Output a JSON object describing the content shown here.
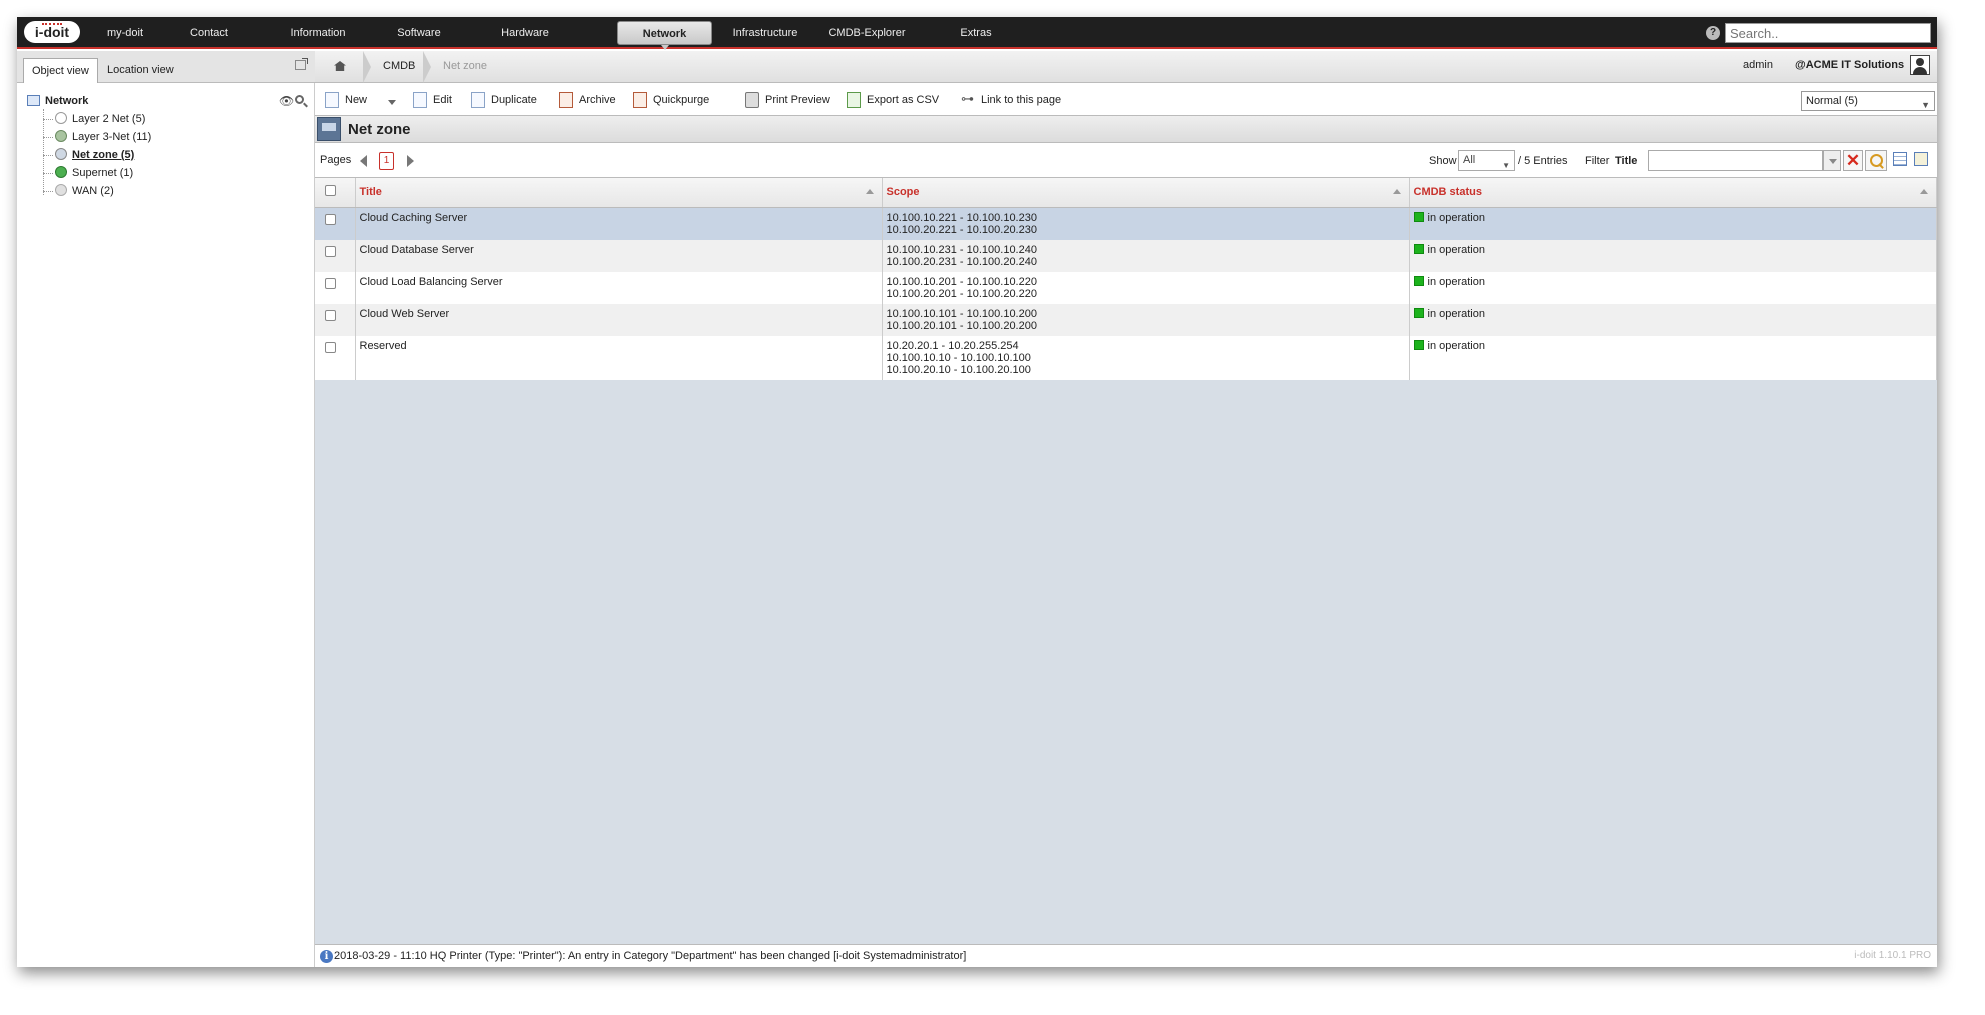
{
  "app": {
    "logo_text": "i-doit"
  },
  "topnav": {
    "items": [
      "my-doit",
      "Contact",
      "Information",
      "Software",
      "Hardware",
      "Network",
      "Infrastructure",
      "CMDB-Explorer",
      "Extras"
    ],
    "active": "Network",
    "search_placeholder": "Search.."
  },
  "left": {
    "tabs": [
      "Object view",
      "Location view"
    ],
    "active_tab": "Object view",
    "tree": {
      "root": "Network",
      "items": [
        {
          "label": "Layer 2 Net (5)",
          "color": "#ffffff"
        },
        {
          "label": "Layer 3-Net (11)",
          "color": "#a9c4a0"
        },
        {
          "label": "Net zone (5)",
          "color": "#cfd8e3",
          "selected": true
        },
        {
          "label": "Supernet (1)",
          "color": "#4caf50"
        },
        {
          "label": "WAN (2)",
          "color": "#e0e0e0"
        }
      ]
    }
  },
  "breadcrumb": {
    "items": [
      "CMDB",
      "Net zone"
    ]
  },
  "user": {
    "name": "admin",
    "tenant": "ACME IT Solutions"
  },
  "toolbar": {
    "new": "New",
    "edit": "Edit",
    "duplicate": "Duplicate",
    "archive": "Archive",
    "quickpurge": "Quickpurge",
    "print_preview": "Print Preview",
    "export_csv": "Export as CSV",
    "link_page": "Link to this page",
    "view_mode": "Normal (5)"
  },
  "page": {
    "title": "Net zone"
  },
  "pager": {
    "pages_label": "Pages",
    "current_page": "1",
    "show_label": "Show",
    "show_value": "All",
    "entries": "/ 5 Entries",
    "filter_label": "Filter",
    "filter_field": "Title"
  },
  "table": {
    "columns": [
      "Title",
      "Scope",
      "CMDB status"
    ],
    "rows": [
      {
        "title": "Cloud Caching Server",
        "scope": [
          "10.100.10.221 - 10.100.10.230",
          "10.100.20.221 - 10.100.20.230"
        ],
        "status": "in operation"
      },
      {
        "title": "Cloud Database Server",
        "scope": [
          "10.100.10.231 - 10.100.10.240",
          "10.100.20.231 - 10.100.20.240"
        ],
        "status": "in operation"
      },
      {
        "title": "Cloud Load Balancing Server",
        "scope": [
          "10.100.10.201 - 10.100.10.220",
          "10.100.20.201 - 10.100.20.220"
        ],
        "status": "in operation"
      },
      {
        "title": "Cloud Web Server",
        "scope": [
          "10.100.10.101 - 10.100.10.200",
          "10.100.20.101 - 10.100.20.200"
        ],
        "status": "in operation"
      },
      {
        "title": "Reserved",
        "scope": [
          "10.20.20.1 - 10.20.255.254",
          "10.100.10.10 - 10.100.10.100",
          "10.100.20.10 - 10.100.20.100"
        ],
        "status": "in operation"
      }
    ]
  },
  "statusbar": {
    "message": "2018-03-29 - 11:10 HQ Printer (Type: \"Printer\"): An entry in Category \"Department\" has been changed [i-doit Systemadministrator]",
    "version": "i-doit 1.10.1 PRO"
  },
  "colors": {
    "accent": "#c8312b",
    "status_ok": "#1db31d",
    "nav_bg": "#1f1f1f"
  }
}
